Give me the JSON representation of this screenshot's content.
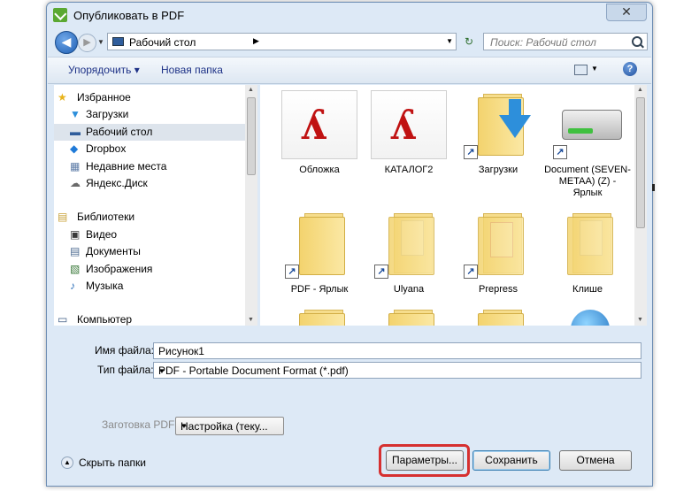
{
  "window": {
    "title": "Опубликовать в PDF",
    "close_glyph": "✕"
  },
  "address": {
    "path": "Рабочий стол",
    "search_placeholder": "Поиск: Рабочий стол"
  },
  "toolbar": {
    "organize": "Упорядочить ▾",
    "new_folder": "Новая папка",
    "help": "?"
  },
  "nav": {
    "favorites": "Избранное",
    "downloads": "Загрузки",
    "desktop": "Рабочий стол",
    "dropbox": "Dropbox",
    "recent": "Недавние места",
    "yadisk": "Яндекс.Диск",
    "libraries": "Библиотеки",
    "video": "Видео",
    "documents": "Документы",
    "images": "Изображения",
    "music": "Музыка",
    "computer": "Компьютер"
  },
  "files": {
    "f1": "Обложка",
    "f2": "КАТАЛОГ2",
    "f3": "Загрузки",
    "f4": "Document (SEVEN-METAA) (Z) - Ярлык",
    "f5": "PDF - Ярлык",
    "f6": "Ulyana",
    "f7": "Prepress",
    "f8": "Клише"
  },
  "form": {
    "filename_label": "Имя файла:",
    "filename_value": "Рисунок1",
    "filetype_label": "Тип файла:",
    "filetype_value": "PDF - Portable Document Format (*.pdf)",
    "preset_label": "Заготовка PDF:",
    "preset_value": "Настройка (теку..."
  },
  "footer": {
    "hide_folders": "Скрыть папки",
    "params": "Параметры...",
    "save": "Сохранить",
    "cancel": "Отмена"
  },
  "colors": {
    "highlight": "#d63030",
    "link": "#1e3287"
  }
}
